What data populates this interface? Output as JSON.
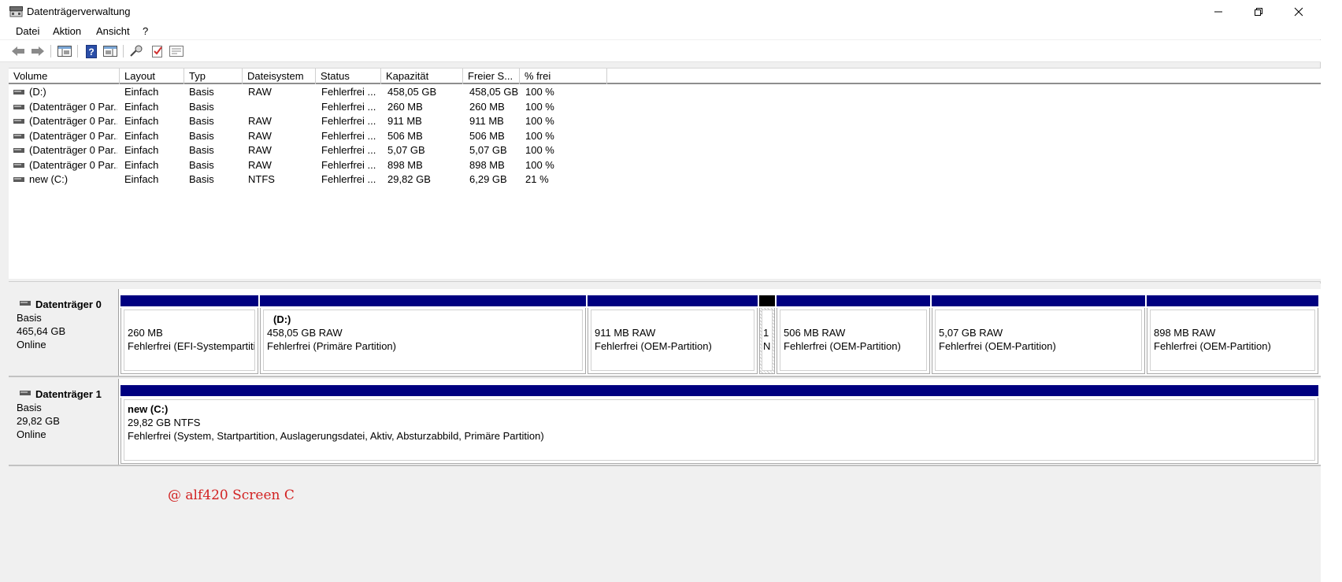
{
  "window": {
    "title": "Datenträgerverwaltung",
    "buttons": {
      "minimize": "minimize-icon",
      "maximize": "restore-icon",
      "close": "close-icon"
    }
  },
  "menu": [
    "Datei",
    "Aktion",
    "Ansicht",
    "?"
  ],
  "toolbar": {
    "icons": [
      "back-arrow-icon",
      "forward-arrow-icon",
      "console-tree-icon",
      "help-icon",
      "action-pane-icon",
      "connect-icon",
      "check-icon",
      "properties-icon"
    ]
  },
  "volume_list": {
    "columns": [
      "Volume",
      "Layout",
      "Typ",
      "Dateisystem",
      "Status",
      "Kapazität",
      "Freier S...",
      "% frei"
    ],
    "rows": [
      [
        "(D:)",
        "Einfach",
        "Basis",
        "RAW",
        "Fehlerfrei ...",
        "458,05 GB",
        "458,05 GB",
        "100 %"
      ],
      [
        "(Datenträger 0 Par...",
        "Einfach",
        "Basis",
        "",
        "Fehlerfrei ...",
        "260 MB",
        "260 MB",
        "100 %"
      ],
      [
        "(Datenträger 0 Par...",
        "Einfach",
        "Basis",
        "RAW",
        "Fehlerfrei ...",
        "911 MB",
        "911 MB",
        "100 %"
      ],
      [
        "(Datenträger 0 Par...",
        "Einfach",
        "Basis",
        "RAW",
        "Fehlerfrei ...",
        "506 MB",
        "506 MB",
        "100 %"
      ],
      [
        "(Datenträger 0 Par...",
        "Einfach",
        "Basis",
        "RAW",
        "Fehlerfrei ...",
        "5,07 GB",
        "5,07 GB",
        "100 %"
      ],
      [
        "(Datenträger 0 Par...",
        "Einfach",
        "Basis",
        "RAW",
        "Fehlerfrei ...",
        "898 MB",
        "898 MB",
        "100 %"
      ],
      [
        "new (C:)",
        "Einfach",
        "Basis",
        "NTFS",
        "Fehlerfrei ...",
        "29,82 GB",
        "6,29 GB",
        "21 %"
      ]
    ]
  },
  "disks": [
    {
      "name": "Datenträger 0",
      "type": "Basis",
      "size": "465,64 GB",
      "status": "Online",
      "partitions": [
        {
          "title": "",
          "size": "260 MB",
          "status": "Fehlerfrei (EFI-Systempartiti"
        },
        {
          "title": "(D:)",
          "size": "458,05 GB RAW",
          "status": "Fehlerfrei (Primäre Partition)"
        },
        {
          "title": "",
          "size": "911 MB RAW",
          "status": "Fehlerfrei (OEM-Partition)"
        },
        {
          "title": "",
          "size": "1",
          "status": "N"
        },
        {
          "title": "",
          "size": "506 MB RAW",
          "status": "Fehlerfrei (OEM-Partition)"
        },
        {
          "title": "",
          "size": "5,07 GB RAW",
          "status": "Fehlerfrei (OEM-Partition)"
        },
        {
          "title": "",
          "size": "898 MB RAW",
          "status": "Fehlerfrei (OEM-Partition)"
        }
      ]
    },
    {
      "name": "Datenträger 1",
      "type": "Basis",
      "size": "29,82 GB",
      "status": "Online",
      "partitions": [
        {
          "title": "new  (C:)",
          "size": "29,82 GB NTFS",
          "status": "Fehlerfrei (System, Startpartition, Auslagerungsdatei, Aktiv, Absturzabbild, Primäre Partition)"
        }
      ]
    }
  ],
  "watermark": "@ alf420  Screen C",
  "colors": {
    "partition_bar": "#000080",
    "unallocated_bar": "#000000",
    "watermark": "#d22222"
  }
}
